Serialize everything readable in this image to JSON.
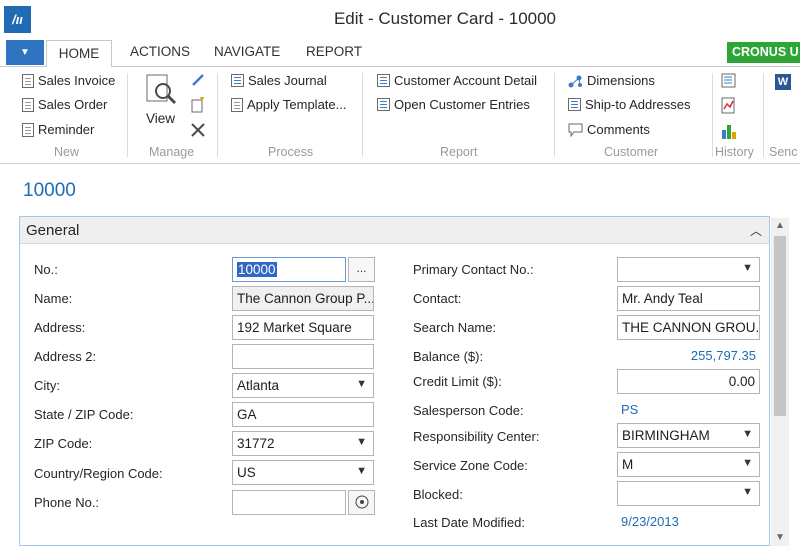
{
  "window": {
    "title": "Edit - Customer Card - 10000"
  },
  "tabs": {
    "home": "HOME",
    "actions": "ACTIONS",
    "navigate": "NAVIGATE",
    "report": "REPORT"
  },
  "company": "CRONUS U",
  "ribbon": {
    "new": {
      "label": "New",
      "items": [
        "Sales Invoice",
        "Sales Order",
        "Reminder"
      ]
    },
    "manage": {
      "label": "Manage",
      "view": "View"
    },
    "process": {
      "label": "Process",
      "items": [
        "Sales Journal",
        "Apply Template..."
      ]
    },
    "report": {
      "label": "Report",
      "items": [
        "Customer Account Detail",
        "Open Customer Entries"
      ]
    },
    "customer": {
      "label": "Customer",
      "items": [
        "Dimensions",
        "Ship-to Addresses",
        "Comments"
      ]
    },
    "history": {
      "label": "History"
    },
    "send": {
      "label": "Senc"
    }
  },
  "record": {
    "title": "10000"
  },
  "general": {
    "title": "General",
    "left": {
      "no_label": "No.:",
      "no_value": "10000",
      "name_label": "Name:",
      "name_value": "The Cannon Group P...",
      "address_label": "Address:",
      "address_value": "192 Market Square",
      "address2_label": "Address 2:",
      "address2_value": "",
      "city_label": "City:",
      "city_value": "Atlanta",
      "state_label": "State / ZIP Code:",
      "state_value": "GA",
      "zip_label": "ZIP Code:",
      "zip_value": "31772",
      "country_label": "Country/Region Code:",
      "country_value": "US",
      "phone_label": "Phone No.:",
      "phone_value": ""
    },
    "right": {
      "primary_contact_label": "Primary Contact No.:",
      "primary_contact_value": "",
      "contact_label": "Contact:",
      "contact_value": "Mr. Andy Teal",
      "search_label": "Search Name:",
      "search_value": "THE CANNON GROU...",
      "balance_label": "Balance ($):",
      "balance_value": "255,797.35",
      "credit_label": "Credit Limit ($):",
      "credit_value": "0.00",
      "salesperson_label": "Salesperson Code:",
      "salesperson_value": "PS",
      "responsibility_label": "Responsibility Center:",
      "responsibility_value": "BIRMINGHAM",
      "service_label": "Service Zone Code:",
      "service_value": "M",
      "blocked_label": "Blocked:",
      "blocked_value": "",
      "modified_label": "Last Date Modified:",
      "modified_value": "9/23/2013"
    }
  },
  "colors": {
    "accent": "#1f6cb5",
    "company_badge": "#2da637",
    "link": "#1f6cb5"
  }
}
